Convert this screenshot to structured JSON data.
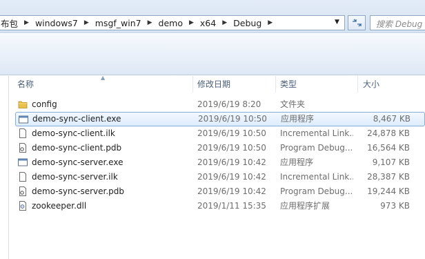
{
  "address_bar": {
    "crumbs": [
      "布包",
      "windows7",
      "msgf_win7",
      "demo",
      "x64",
      "Debug"
    ],
    "search_placeholder": "搜索 Debug"
  },
  "columns": {
    "name": "名称",
    "date": "修改日期",
    "type": "类型",
    "size": "大小"
  },
  "files": [
    {
      "name": "config",
      "date": "2019/6/19 8:20",
      "type": "文件夹",
      "size": "",
      "icon": "folder-icon",
      "selected": false
    },
    {
      "name": "demo-sync-client.exe",
      "date": "2019/6/19 10:50",
      "type": "应用程序",
      "size": "8,467 KB",
      "icon": "exe-icon",
      "selected": true
    },
    {
      "name": "demo-sync-client.ilk",
      "date": "2019/6/19 10:50",
      "type": "Incremental Link...",
      "size": "24,878 KB",
      "icon": "file-icon",
      "selected": false
    },
    {
      "name": "demo-sync-client.pdb",
      "date": "2019/6/19 10:50",
      "type": "Program Debug...",
      "size": "16,564 KB",
      "icon": "pdb-icon",
      "selected": false
    },
    {
      "name": "demo-sync-server.exe",
      "date": "2019/6/19 10:42",
      "type": "应用程序",
      "size": "9,107 KB",
      "icon": "exe-icon",
      "selected": false
    },
    {
      "name": "demo-sync-server.ilk",
      "date": "2019/6/19 10:42",
      "type": "Incremental Link...",
      "size": "28,387 KB",
      "icon": "file-icon",
      "selected": false
    },
    {
      "name": "demo-sync-server.pdb",
      "date": "2019/6/19 10:42",
      "type": "Program Debug...",
      "size": "19,244 KB",
      "icon": "pdb-icon",
      "selected": false
    },
    {
      "name": "zookeeper.dll",
      "date": "2019/1/11 15:35",
      "type": "应用程序扩展",
      "size": "973 KB",
      "icon": "dll-icon",
      "selected": false
    }
  ]
}
